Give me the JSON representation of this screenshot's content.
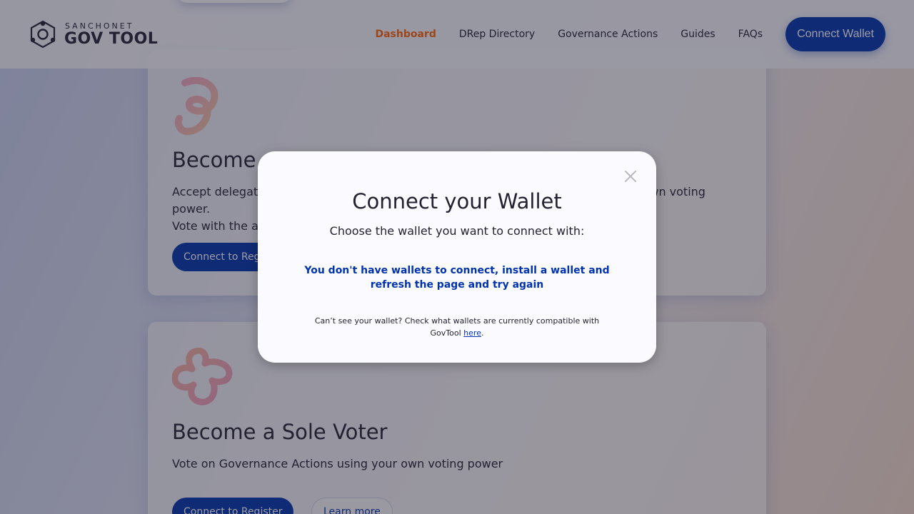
{
  "header": {
    "logo_top": "SANCHONET",
    "logo_bottom": "GOV TOOL",
    "logo_icon": "govtool-hex-logo-icon",
    "nav": {
      "dashboard": "Dashboard",
      "drep_directory": "DRep Directory",
      "governance_actions": "Governance Actions",
      "guides": "Guides",
      "faqs": "FAQs"
    },
    "connect_wallet": "Connect Wallet"
  },
  "cards": {
    "drep": {
      "title": "Become a DRep",
      "description_line1": "Accept delegated voting power from other ADA holders, and combine it with your own voting power.",
      "description_line2": "Vote with the accumulated Power on Governance Actions.",
      "register_label": "Connect to Register"
    },
    "sole_voter": {
      "title": "Become a Sole Voter",
      "description": "Vote on Governance Actions using your own voting power",
      "register_label": "Connect to Register",
      "learn_more_label": "Learn more"
    }
  },
  "modal": {
    "title": "Connect your Wallet",
    "subtitle": "Choose the wallet you want to connect with:",
    "warning": "You don't have wallets to connect, install a wallet and refresh the page and try again",
    "footer_text": "Can’t see your wallet? Check what wallets are currently compatible with GovTool",
    "footer_link": "here",
    "footer_end": ".",
    "close_icon": "close-icon"
  },
  "colors": {
    "primary": "#0033ad",
    "active_nav": "#ff640a",
    "text": "#242232",
    "modal_bg": "#fbfbff"
  }
}
